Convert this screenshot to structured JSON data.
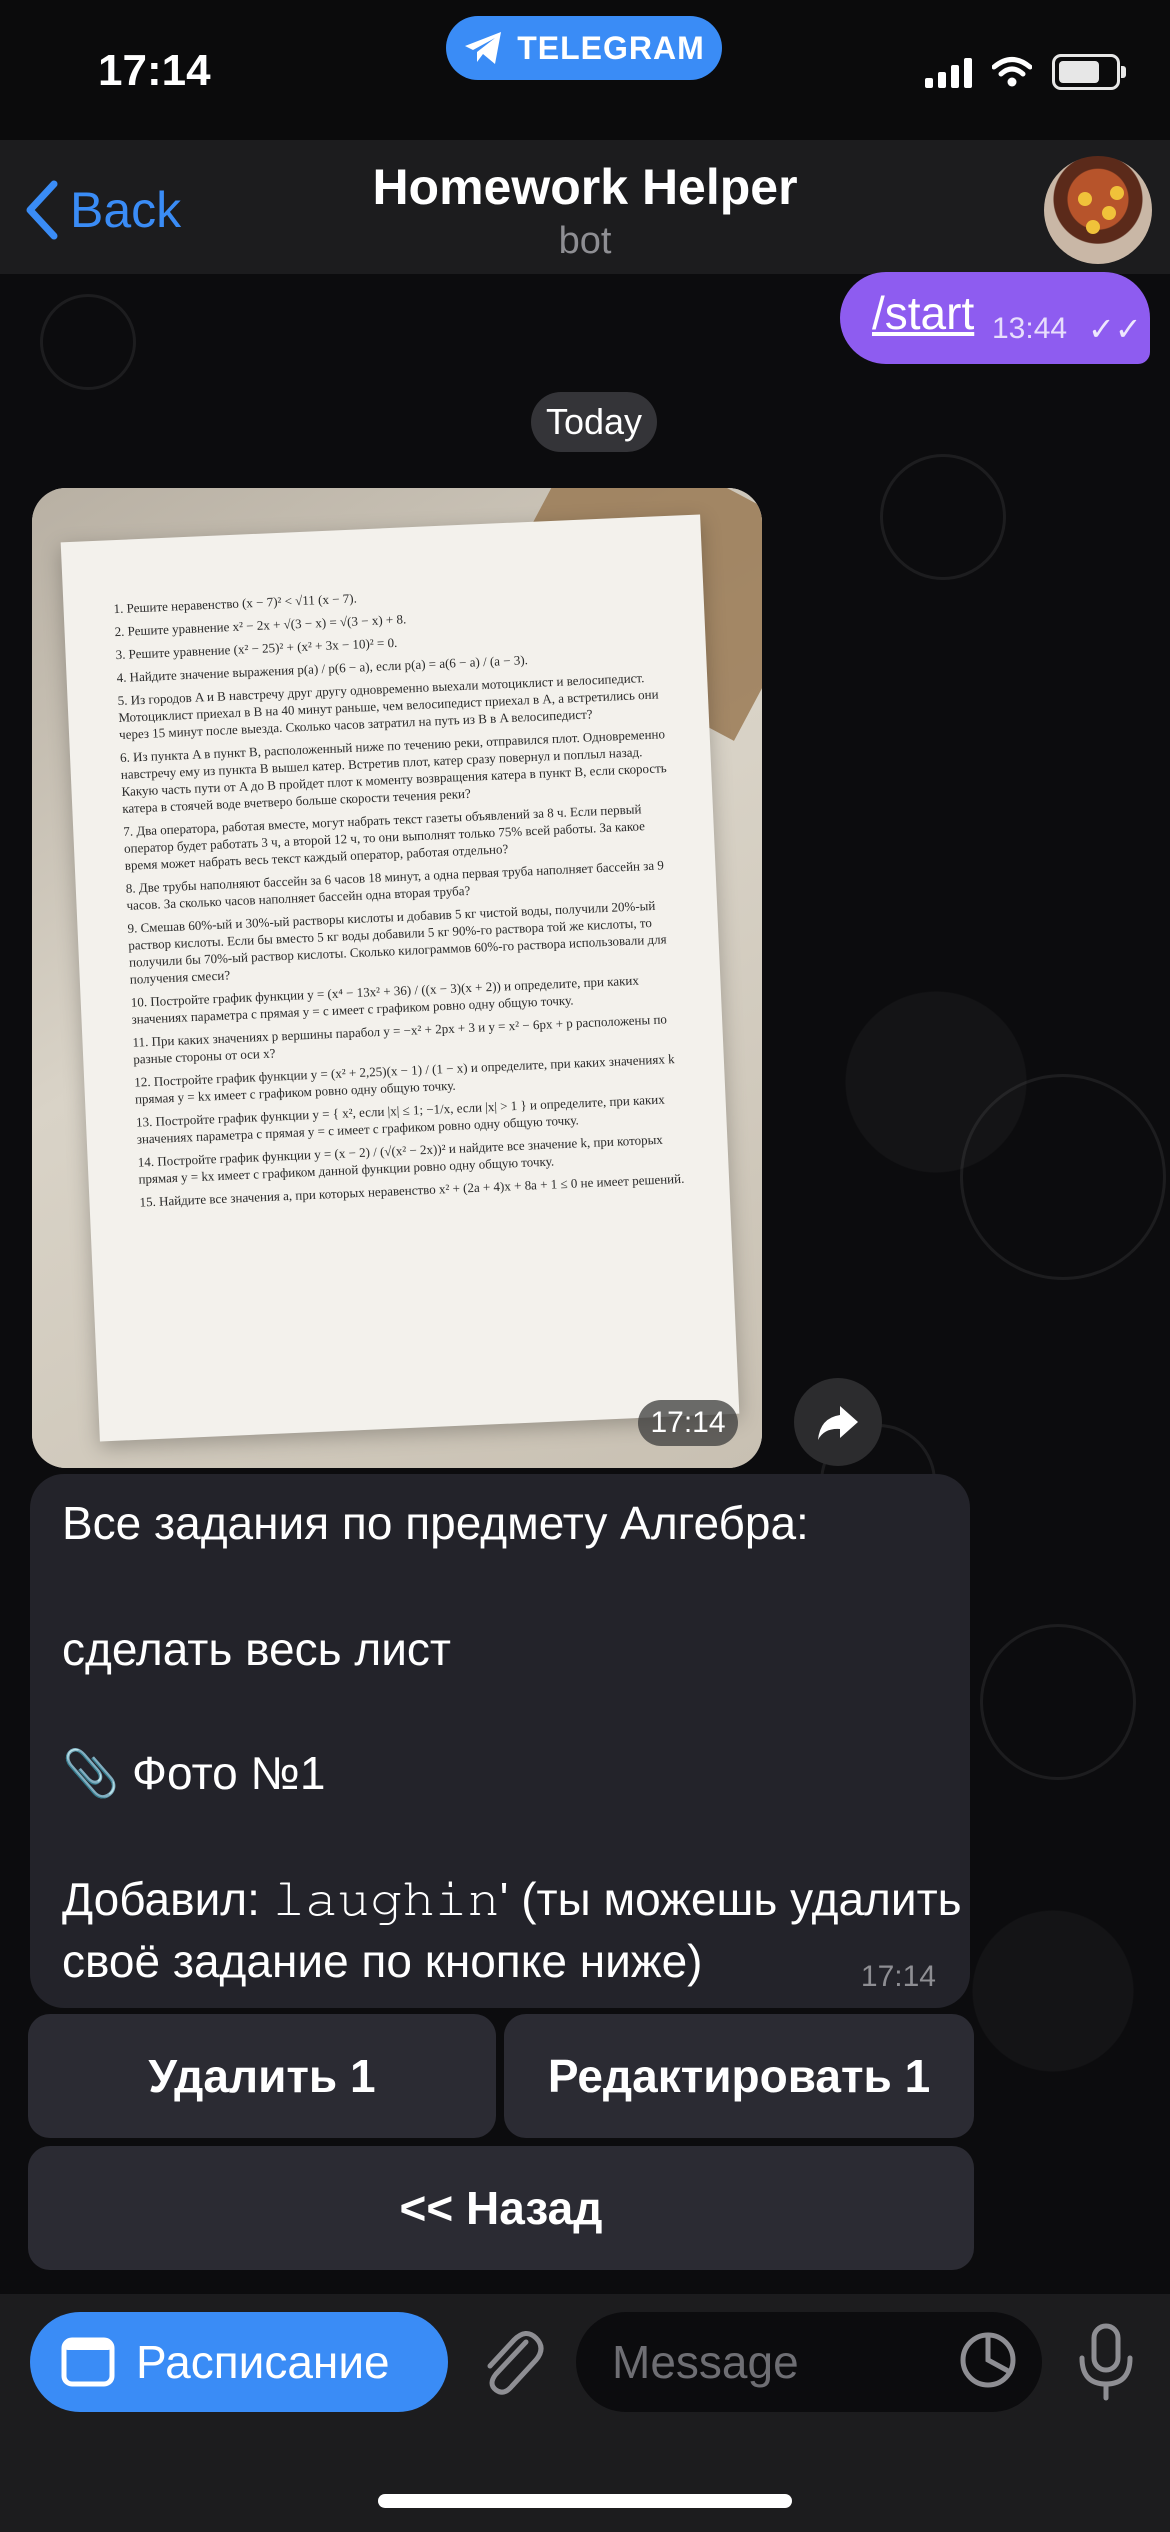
{
  "status": {
    "time": "17:14",
    "pill_label": "TELEGRAM"
  },
  "header": {
    "back_label": "Back",
    "title": "Homework Helper",
    "subtitle": "bot"
  },
  "outgoing": {
    "text": "/start",
    "time": "13:44"
  },
  "date_separator": "Today",
  "photo": {
    "time": "17:14",
    "paper_lines": [
      "1. Решите неравенство (x − 7)² < √11 (x − 7).",
      "2. Решите уравнение x² − 2x + √(3 − x) = √(3 − x) + 8.",
      "3. Решите уравнение (x² − 25)² + (x² + 3x − 10)² = 0.",
      "4. Найдите значение выражения p(a) / p(6 − a), если p(a) = a(6 − a) / (a − 3).",
      "5. Из городов A и B навстречу друг другу одновременно выехали мотоциклист и велосипедист. Мотоциклист приехал в B на 40 минут раньше, чем велосипедист приехал в A, а встретились они через 15 минут после выезда. Сколько часов затратил на путь из B в A велосипедист?",
      "6. Из пункта A в пункт B, расположенный ниже по течению реки, отправился плот. Одновременно навстречу ему из пункта B вышел катер. Встретив плот, катер сразу повернул и поплыл назад. Какую часть пути от A до B пройдет плот к моменту возвращения катера в пункт B, если скорость катера в стоячей воде вчетверо больше скорости течения реки?",
      "7. Два оператора, работая вместе, могут набрать текст газеты объявлений за 8 ч. Если первый оператор будет работать 3 ч, а второй 12 ч, то они выполнят только 75% всей работы. За какое время может набрать весь текст каждый оператор, работая отдельно?",
      "8. Две трубы наполняют бассейн за 6 часов 18 минут, а одна первая труба наполняет бассейн за 9 часов. За сколько часов наполняет бассейн одна вторая труба?",
      "9. Смешав 60%-ый и 30%-ый растворы кислоты и добавив 5 кг чистой воды, получили 20%-ый раствор кислоты. Если бы вместо 5 кг воды добавили 5 кг 90%-го раствора той же кислоты, то получили бы 70%-ый раствор кислоты. Сколько килограммов 60%-го раствора использовали для получения смеси?",
      "10. Постройте график функции y = (x⁴ − 13x² + 36) / ((x − 3)(x + 2)) и определите, при каких значениях параметра c прямая y = c имеет с графиком ровно одну общую точку.",
      "11. При каких значениях p вершины парабол y = −x² + 2px + 3 и y = x² − 6px + p расположены по разные стороны от оси x?",
      "12. Постройте график функции y = (x² + 2,25)(x − 1) / (1 − x) и определите, при каких значениях k прямая y = kx имеет с графиком ровно одну общую точку.",
      "13. Постройте график функции y = { x², если |x| ≤ 1; −1/x, если |x| > 1 } и определите, при каких значениях параметра c прямая y = c имеет с графиком ровно одну общую точку.",
      "14. Постройте график функции y = (x − 2) / (√(x² − 2x))² и найдите все значение k, при которых прямая y = kx имеет с графиком данной функции ровно одну общую точку.",
      "15. Найдите все значения a, при которых неравенство x² + (2a + 4)x + 8a + 1 ≤ 0 не имеет решений."
    ]
  },
  "message": {
    "line1": "Все задания по предмету Алгебра:",
    "line2": "сделать весь лист",
    "line3": "📎 Фото №1",
    "line4": "Добавил: 𝚕𝚊𝚞𝚐𝚑𝚒𝚗' (ты можешь удалить",
    "line5": "своё задание по кнопке ниже)",
    "time": "17:14"
  },
  "keyboard": {
    "delete_label": "Удалить 1",
    "edit_label": "Редактировать 1",
    "back_label": "<< Назад"
  },
  "input": {
    "menu_label": "Расписание",
    "placeholder": "Message"
  },
  "colors": {
    "accent": "#3a8cf6",
    "outgoing_bubble": "#8e5cf0",
    "incoming_bubble": "#23232a"
  }
}
